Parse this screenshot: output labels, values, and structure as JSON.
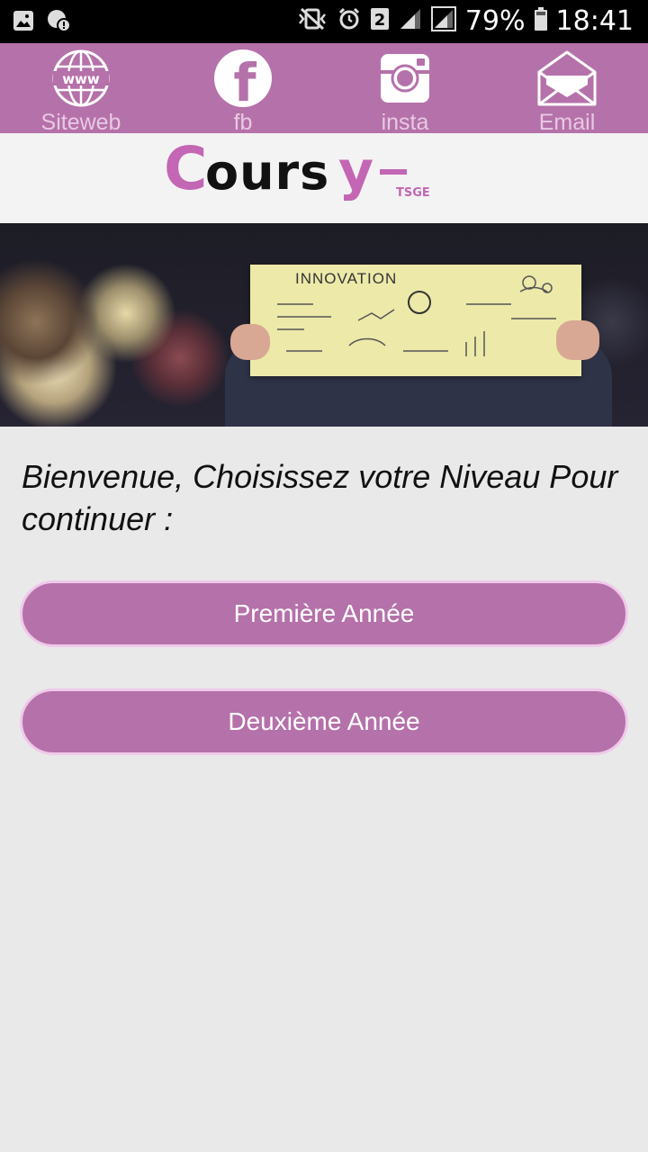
{
  "status_bar": {
    "battery_percent": "79%",
    "time": "18:41",
    "sim_number": "2"
  },
  "social": {
    "items": [
      {
        "label": "Siteweb",
        "icon": "globe-icon",
        "icon_text": "www"
      },
      {
        "label": "fb",
        "icon": "facebook-icon",
        "icon_text": "f"
      },
      {
        "label": "insta",
        "icon": "instagram-icon"
      },
      {
        "label": "Email",
        "icon": "envelope-icon"
      }
    ]
  },
  "logo": {
    "text": "Coursy-",
    "subtext": "TSGE"
  },
  "banner": {
    "board_text": "INNOVATION"
  },
  "welcome_text": "Bienvenue, Choisissez votre Niveau Pour continuer :",
  "buttons": {
    "first_year": "Première Année",
    "second_year": "Deuxième Année"
  },
  "colors": {
    "accent": "#b571aa",
    "logo_c": "#c366b4",
    "logo_y": "#c366b4"
  }
}
